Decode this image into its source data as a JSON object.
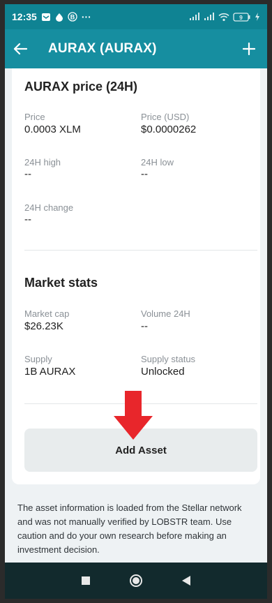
{
  "status_bar": {
    "time": "12:35",
    "more": "···",
    "battery": "9"
  },
  "header": {
    "title": "AURAX (AURAX)"
  },
  "price_section": {
    "title": "AURAX price (24H)",
    "price_label": "Price",
    "price_value": "0.0003 XLM",
    "price_usd_label": "Price (USD)",
    "price_usd_value": "$0.0000262",
    "high_label": "24H high",
    "high_value": "--",
    "low_label": "24H low",
    "low_value": "--",
    "change_label": "24H change",
    "change_value": "--"
  },
  "market_section": {
    "title": "Market stats",
    "cap_label": "Market cap",
    "cap_value": "$26.23K",
    "volume_label": "Volume 24H",
    "volume_value": "--",
    "supply_label": "Supply",
    "supply_value": "1B AURAX",
    "supply_status_label": "Supply status",
    "supply_status_value": "Unlocked"
  },
  "add_asset_label": "Add Asset",
  "disclaimer": "The asset information is loaded from the Stellar network and was not manually verified by LOBSTR team. Use caution and do your own research before making an investment decision.",
  "colors": {
    "accent": "#168ea0",
    "status_bar": "#0f8393",
    "arrow": "#e8262b",
    "nav_bar": "#122a2d"
  }
}
